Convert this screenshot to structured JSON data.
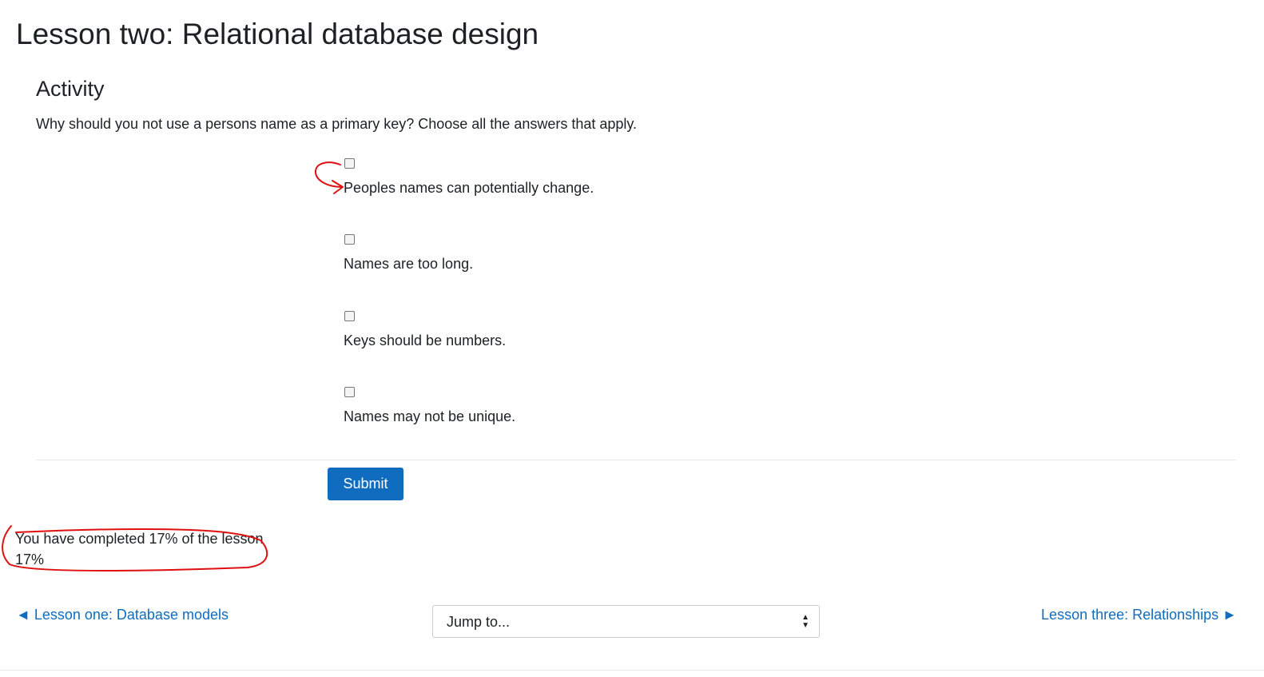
{
  "page": {
    "title": "Lesson two: Relational database design"
  },
  "activity": {
    "heading": "Activity",
    "question": "Why should you not use a persons name as a primary key? Choose all the answers that apply.",
    "options": [
      {
        "label": "Peoples names can potentially change.",
        "checked": false
      },
      {
        "label": "Names are too long.",
        "checked": false
      },
      {
        "label": "Keys should be numbers.",
        "checked": false
      },
      {
        "label": "Names may not be unique.",
        "checked": false
      }
    ],
    "submit_label": "Submit"
  },
  "progress": {
    "text": "You have completed 17% of the lesson",
    "percent_label": "17%",
    "percent_value": 17
  },
  "navigation": {
    "prev_label": "◄ Lesson one: Database models",
    "next_label": "Lesson three: Relationships ►",
    "jump_label": "Jump to..."
  },
  "colors": {
    "accent": "#0f6cbf",
    "annotation": "#e01010"
  }
}
